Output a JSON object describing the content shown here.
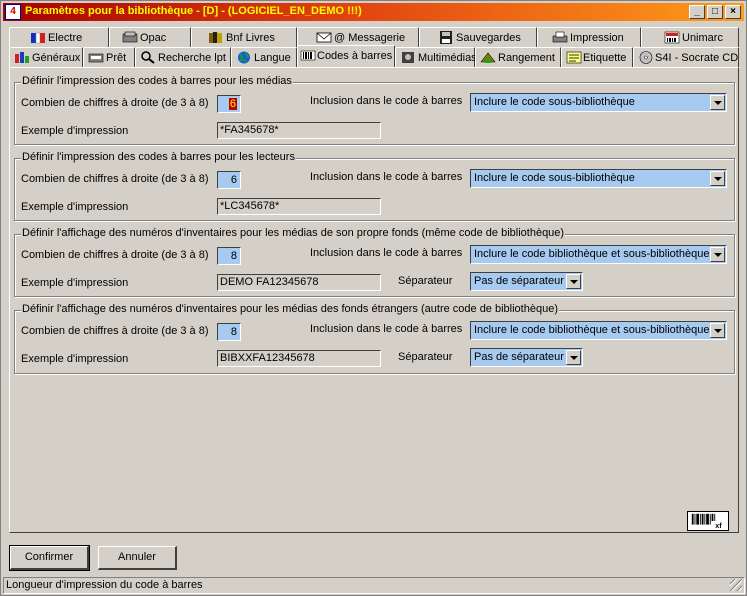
{
  "window": {
    "title": "Paramètres pour la bibliothèque - [D] - (LOGICIEL_EN_DEMO !!!)",
    "min_label": "_",
    "max_label": "□",
    "close_label": "×"
  },
  "tabs_back": [
    {
      "label": "Electre",
      "icon": "electre-icon"
    },
    {
      "label": "Opac",
      "icon": "opac-icon"
    },
    {
      "label": "Bnf Livres",
      "icon": "books-icon"
    },
    {
      "label": "@ Messagerie",
      "icon": "mail-icon"
    },
    {
      "label": "Sauvegardes",
      "icon": "disk-icon"
    },
    {
      "label": "Impression",
      "icon": "printer-icon"
    },
    {
      "label": "Unimarc",
      "icon": "unimarc-icon"
    }
  ],
  "tabs_front": [
    {
      "label": "Généraux",
      "icon": "general-icon"
    },
    {
      "label": "Prêt",
      "icon": "loan-icon"
    },
    {
      "label": "Recherche lpt",
      "icon": "search-icon"
    },
    {
      "label": "Langue",
      "icon": "globe-icon"
    },
    {
      "label": "Codes à barres",
      "icon": "barcode-icon"
    },
    {
      "label": "Multimédias",
      "icon": "multimedia-icon"
    },
    {
      "label": "Rangement",
      "icon": "storage-icon"
    },
    {
      "label": "Etiquette",
      "icon": "label-icon"
    },
    {
      "label": "S4I - Socrate CD",
      "icon": "cd-icon"
    }
  ],
  "active_tab": "Codes à barres",
  "groups": [
    {
      "title": "Définir l'impression des codes à barres pour les médias",
      "digits_label": "Combien de chiffres à droite (de 3 à 8)",
      "digits_value": "6",
      "inclusion_label": "Inclusion dans le code à barres",
      "inclusion_value": "Inclure le code sous-bibliothèque",
      "example_label": "Exemple d'impression",
      "example_value": "*FA345678*"
    },
    {
      "title": "Définir l'impression des codes à barres pour les lecteurs",
      "digits_label": "Combien de chiffres à droite (de 3 à 8)",
      "digits_value": "6",
      "inclusion_label": "Inclusion dans le code à barres",
      "inclusion_value": "Inclure le code sous-bibliothèque",
      "example_label": "Exemple d'impression",
      "example_value": "*LC345678*"
    },
    {
      "title": "Définir l'affichage des numéros d'inventaires pour les médias de son propre fonds (même code de bibliothèque)",
      "digits_label": "Combien de chiffres à droite (de 3 à 8)",
      "digits_value": "8",
      "inclusion_label": "Inclusion dans le code à barres",
      "inclusion_value": "Inclure le code bibliothèque et sous-bibliothèque",
      "example_label": "Exemple d'impression",
      "example_value": "DEMO FA12345678",
      "separator_label": "Séparateur",
      "separator_value": "Pas de séparateur"
    },
    {
      "title": "Définir l'affichage des numéros d'inventaires pour les médias des fonds étrangers (autre code de bibliothèque)",
      "digits_label": "Combien de chiffres à droite (de 3 à 8)",
      "digits_value": "8",
      "inclusion_label": "Inclusion dans le code à barres",
      "inclusion_value": "Inclure le code bibliothèque et sous-bibliothèque",
      "example_label": "Exemple d'impression",
      "example_value": "BIBXXFA12345678",
      "separator_label": "Séparateur",
      "separator_value": "Pas de séparateur"
    }
  ],
  "buttons": {
    "confirm": "Confirmer",
    "cancel": "Annuler"
  },
  "statusbar": {
    "text": "Longueur d'impression du code à barres"
  }
}
